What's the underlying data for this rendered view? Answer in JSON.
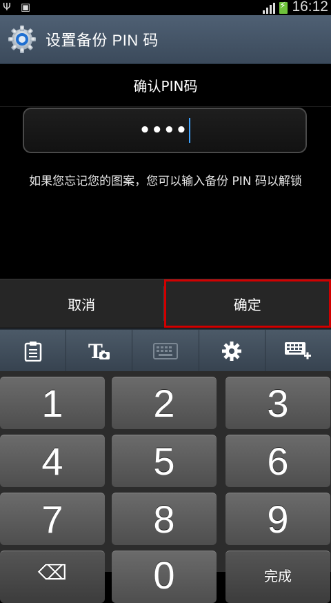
{
  "status_bar": {
    "time": "16:12"
  },
  "app_bar": {
    "title": "设置备份 PIN 码"
  },
  "dialog": {
    "heading": "确认PIN码",
    "pin_value": "••••",
    "hint": "如果您忘记您的图案，您可以输入备份 PIN 码以解锁",
    "cancel_label": "取消",
    "ok_label": "确定"
  },
  "keyboard": {
    "toolbar": [
      "clipboard-icon",
      "text-recognition-icon",
      "keyboard-icon",
      "settings-icon",
      "keyboard-layout-icon"
    ],
    "keys": [
      "1",
      "2",
      "3",
      "4",
      "5",
      "6",
      "7",
      "8",
      "9",
      "0",
      "完成"
    ]
  },
  "colors": {
    "title_bar": "#4a5a6c",
    "highlight": "#d00000",
    "caret": "#3ea3ff"
  }
}
